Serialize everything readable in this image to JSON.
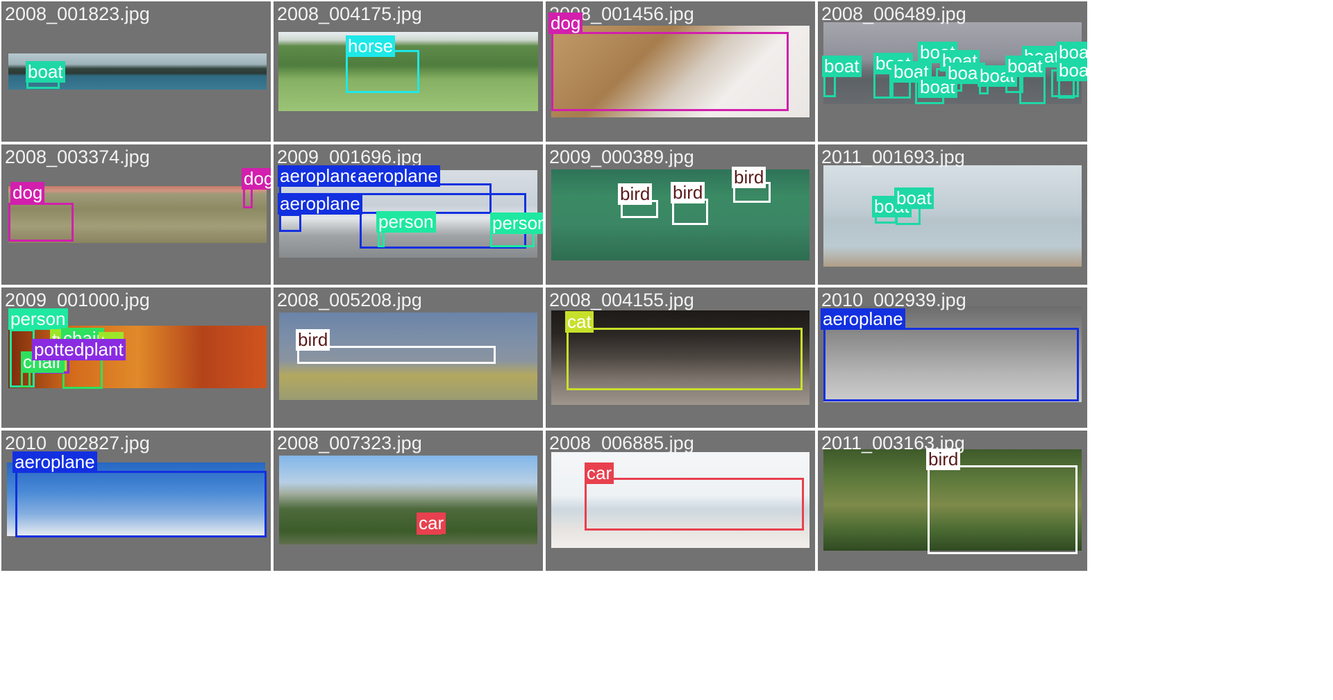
{
  "gallery": {
    "tiles": [
      {
        "filename": "2008_001823.jpg",
        "labels": [
          "boat"
        ]
      },
      {
        "filename": "2008_004175.jpg",
        "labels": [
          "horse"
        ]
      },
      {
        "filename": "2008_001456.jpg",
        "labels": [
          "dog"
        ]
      },
      {
        "filename": "2008_006489.jpg",
        "labels": [
          "boat",
          "boat",
          "boat",
          "boat",
          "boat",
          "boat",
          "boat",
          "boat",
          "boat",
          "boat",
          "boat",
          "boat"
        ]
      },
      {
        "filename": "2008_003374.jpg",
        "labels": [
          "dog",
          "dog"
        ]
      },
      {
        "filename": "2009_001696.jpg",
        "labels": [
          "aeroplane",
          "aeroplane",
          "aeroplane",
          "person",
          "person"
        ]
      },
      {
        "filename": "2009_000389.jpg",
        "labels": [
          "bird",
          "bird",
          "bird"
        ]
      },
      {
        "filename": "2011_001693.jpg",
        "labels": [
          "boat",
          "boat"
        ]
      },
      {
        "filename": "2009_001000.jpg",
        "labels": [
          "person",
          "tv",
          "chair",
          "tor",
          "chair",
          "pottedplant"
        ]
      },
      {
        "filename": "2008_005208.jpg",
        "labels": [
          "bird"
        ]
      },
      {
        "filename": "2008_004155.jpg",
        "labels": [
          "cat"
        ]
      },
      {
        "filename": "2010_002939.jpg",
        "labels": [
          "aeroplane"
        ]
      },
      {
        "filename": "2010_002827.jpg",
        "labels": [
          "aeroplane"
        ]
      },
      {
        "filename": "2008_007323.jpg",
        "labels": [
          "car"
        ]
      },
      {
        "filename": "2008_006885.jpg",
        "labels": [
          "car"
        ]
      },
      {
        "filename": "2011_003163.jpg",
        "labels": [
          "bird"
        ]
      }
    ]
  },
  "class_colors": {
    "boat": "#1ed8a6",
    "horse": "#1ee8e8",
    "dog": "#d21fad",
    "aeroplane": "#1230e0",
    "person": "#1fe8a0",
    "bird": "#ffffff",
    "cat": "#c8e02a",
    "car": "#e8404e",
    "tv": "#9ce62a",
    "chair": "#2ee05e",
    "tor": "#9ce62a",
    "pottedplant": "#8a2be2"
  }
}
